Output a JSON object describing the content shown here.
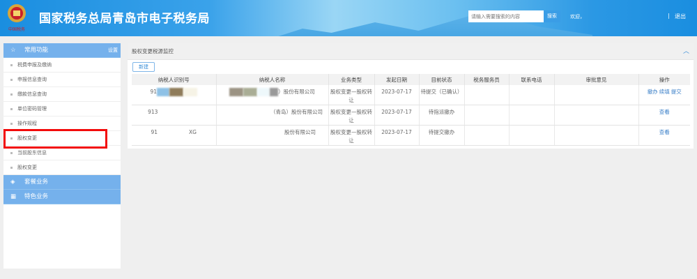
{
  "header": {
    "title": "国家税务总局青岛市电子税务局",
    "search_placeholder": "请输入需要搜索的内容",
    "search_button": "搜索",
    "welcome": "欢迎，",
    "separator": "|",
    "logout": "退出",
    "logo_text": "中国税务"
  },
  "sidebar": {
    "common": {
      "label": "常用功能",
      "settings": "设置",
      "icon": "star-icon"
    },
    "items": [
      {
        "label": "税费申报及缴纳"
      },
      {
        "label": "申报信息查询"
      },
      {
        "label": "缴款信息查询"
      },
      {
        "label": "单位密码管理"
      },
      {
        "label": "操作规程"
      },
      {
        "label": "股权变更"
      },
      {
        "label": "当前股东信息"
      },
      {
        "label": "股权变更"
      }
    ],
    "groups": [
      {
        "label": "套餐业务",
        "icon": "layers-icon"
      },
      {
        "label": "特色业务",
        "icon": "grid-icon"
      }
    ],
    "highlight_color": "#f20b0b"
  },
  "panel": {
    "title": "股权变更税源监控",
    "new_button": "新建",
    "columns": [
      "纳税人识别号",
      "纳税人名称",
      "业务类型",
      "发起日期",
      "目前状态",
      "税务服务员",
      "联系电话",
      "审批意见",
      "操作"
    ],
    "rows": [
      {
        "id": "91",
        "name": "）股份有限公司",
        "type": "股权变更—股权转让",
        "date": "2023-07-17",
        "status": "待提交（已确认）",
        "server": "",
        "phone": "",
        "opinion": "",
        "actions": [
          "撤办",
          "续填",
          "提交"
        ]
      },
      {
        "id": "913",
        "name": "（青岛）股份有限公司",
        "type": "股权变更—股权转让",
        "date": "2023-07-17",
        "status": "待指派撤办",
        "server": "",
        "phone": "",
        "opinion": "",
        "actions": [
          "查看"
        ]
      },
      {
        "id": "91",
        "id_tail": "XG",
        "name": "股份有限公司",
        "type": "股权变更—股权转让",
        "date": "2023-07-17",
        "status": "待提交撤办",
        "server": "",
        "phone": "",
        "opinion": "",
        "actions": [
          "查看"
        ]
      }
    ]
  },
  "colors": {
    "header_blue": "#1a8ee0",
    "sidebar_blue": "#75b1ec",
    "link": "#3a7fc8"
  }
}
